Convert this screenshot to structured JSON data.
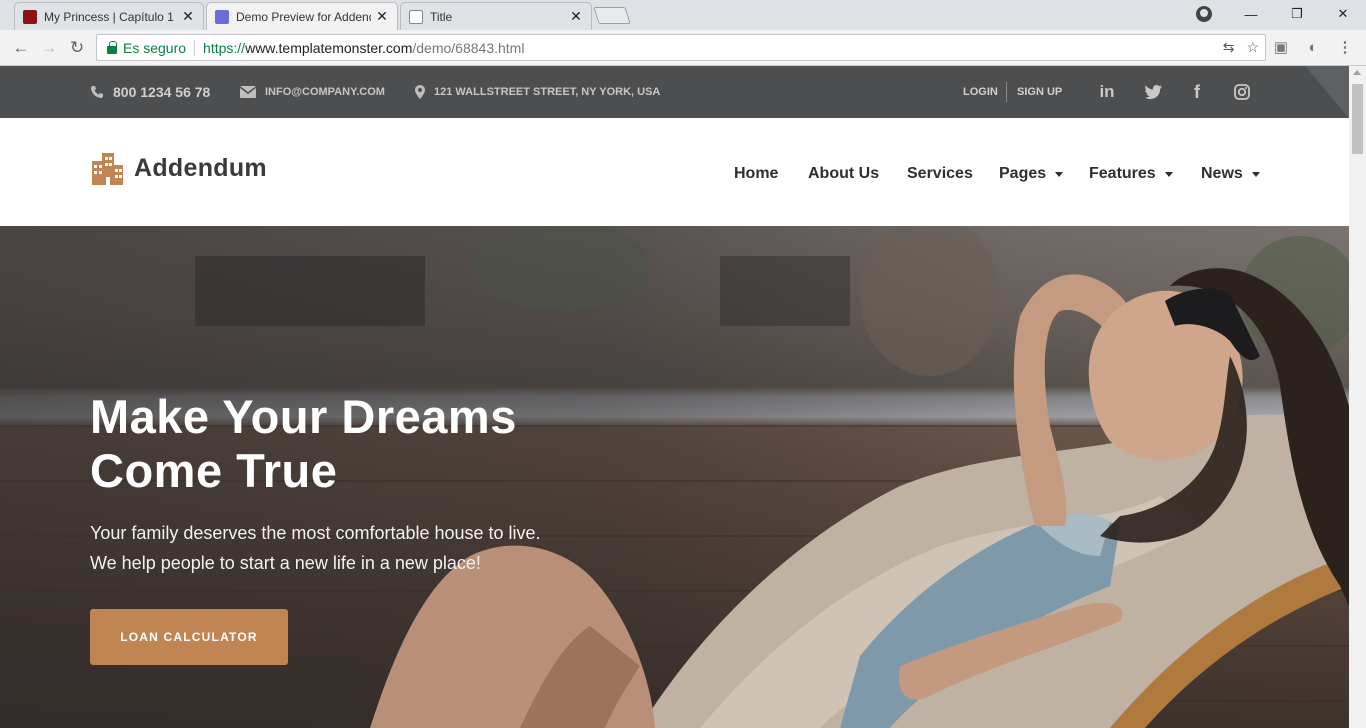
{
  "browser": {
    "tabs": [
      {
        "title": "My Princess | Capítulo 1 |",
        "active": false
      },
      {
        "title": "Demo Preview for Addendum",
        "active": true
      },
      {
        "title": "Title",
        "active": false
      }
    ],
    "address": {
      "secure_label": "Es seguro",
      "url_scheme": "https://",
      "url_host": "www.templatemonster.com",
      "url_path": "/demo/68843.html"
    }
  },
  "topbar": {
    "phone": "800 1234 56 78",
    "email": "INFO@COMPANY.COM",
    "address": "121 WALLSTREET STREET, NY YORK, USA",
    "login": "LOGIN",
    "signup": "SIGN UP",
    "social_icons": [
      "linkedin-icon",
      "twitter-icon",
      "facebook-icon",
      "instagram-icon"
    ]
  },
  "header": {
    "logo_text": "Addendum",
    "menu": [
      "Home",
      "About Us",
      "Services",
      "Pages",
      "Features",
      "News"
    ]
  },
  "hero": {
    "title_line1": "Make Your Dreams",
    "title_line2": "Come True",
    "sub_line1": "Your family deserves the most comfortable house to live.",
    "sub_line2": "We help people to start a new life in a new place!",
    "cta_label": "LOAN CALCULATOR"
  },
  "colors": {
    "accent": "#c08553",
    "topbar": "#4c4e50"
  }
}
